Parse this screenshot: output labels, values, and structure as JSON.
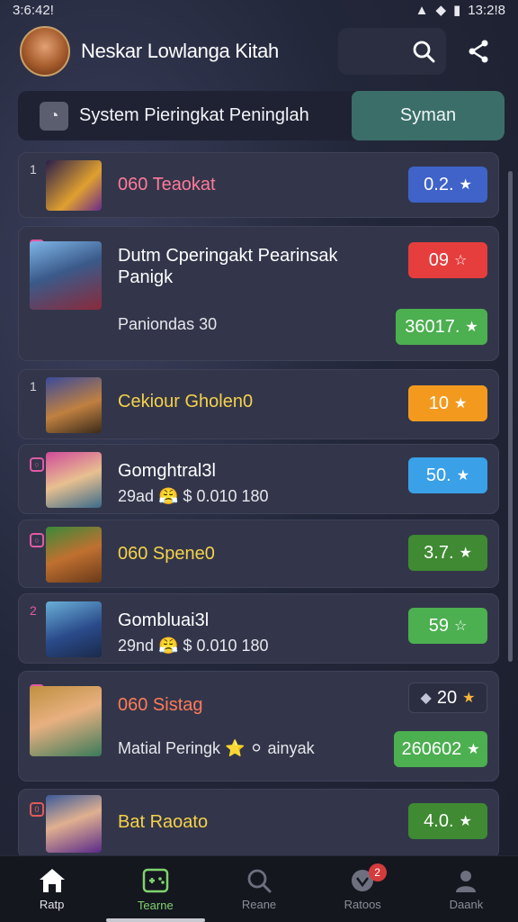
{
  "status_bar": {
    "time_left": "3:6:42!",
    "icons_left": "δ0 ☻",
    "time_right": "13:2!8"
  },
  "header": {
    "title": "Neskar Lowlanga Kitah",
    "search_icon": "search-icon",
    "share_icon": "share-icon"
  },
  "system": {
    "label": "System Pieringkat Peninglah",
    "sync_label": "Syman"
  },
  "items": [
    {
      "rank": "1",
      "name": "060 Teaokat",
      "name_color": "#ff7a9a",
      "score": "0.2.",
      "score_color": "#3f63c9"
    },
    {
      "rank": "",
      "name": "Dutm Cperingakt Pearinsak Panigk",
      "name_color": "#ffffff",
      "sub": "Paniondas 30",
      "score": "09",
      "score_color": "#e63d3d",
      "score2": "36017.",
      "score2_color": "#4caf50"
    },
    {
      "rank": "1",
      "name": "Cekiour Gholen0",
      "name_color": "#f5d24a",
      "score": "10",
      "score_color": "#f39a1e"
    },
    {
      "rank": "",
      "name": "Gomghtral3l",
      "name_color": "#ffffff",
      "sub": "29ad 😤 $ 0.010 180",
      "score": "50.",
      "score_color": "#3aa0e8"
    },
    {
      "rank": "",
      "name": "060 Spene0",
      "name_color": "#f5d24a",
      "score": "3.7.",
      "score_color": "#3f8a32"
    },
    {
      "rank": "2",
      "name": "Gombluai3l",
      "name_color": "#ffffff",
      "sub": "29nd 😤 $ 0.010 180",
      "score": "59",
      "score_color": "#4caf50"
    },
    {
      "rank": "",
      "name": "060 Sistag",
      "name_color": "#ff7a5a",
      "sub": "Matial Peringk ⭐ ⚪ ainyak",
      "score": "20",
      "score_color": "#2b2e40",
      "score2": "260602",
      "score2_color": "#4caf50"
    },
    {
      "rank": "0",
      "name": "Bat Raoato",
      "name_color": "#f5d24a",
      "score": "4.0.",
      "score_color": "#3f8a32"
    }
  ],
  "nav": [
    {
      "label": "Ratp",
      "icon": "home-icon"
    },
    {
      "label": "Tearne",
      "icon": "gamepad-icon"
    },
    {
      "label": "Reane",
      "icon": "search-icon"
    },
    {
      "label": "Ratoos",
      "icon": "trophy-icon",
      "badge": "2"
    },
    {
      "label": "Daank",
      "icon": "user-icon"
    }
  ]
}
